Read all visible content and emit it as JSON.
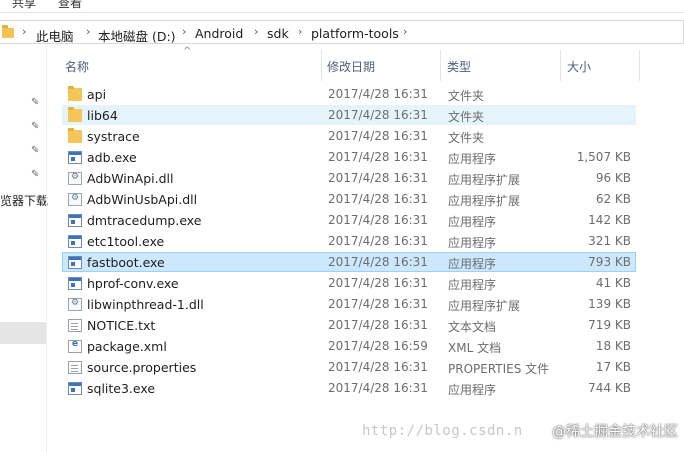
{
  "ribbon": {
    "tab1": "共享",
    "tab2": "查看"
  },
  "breadcrumb": {
    "items": [
      "此电脑",
      "本地磁盘 (D:)",
      "Android",
      "sdk",
      "platform-tools"
    ],
    "separator": "›"
  },
  "nav": {
    "cropped_label": "览器下载"
  },
  "columns": {
    "name": "名称",
    "date": "修改日期",
    "type": "类型",
    "size": "大小"
  },
  "files": [
    {
      "name": "api",
      "date": "2017/4/28 16:31",
      "type": "文件夹",
      "size": "",
      "icon": "folder-icon"
    },
    {
      "name": "lib64",
      "date": "2017/4/28 16:31",
      "type": "文件夹",
      "size": "",
      "icon": "folder-icon"
    },
    {
      "name": "systrace",
      "date": "2017/4/28 16:31",
      "type": "文件夹",
      "size": "",
      "icon": "folder-icon"
    },
    {
      "name": "adb.exe",
      "date": "2017/4/28 16:31",
      "type": "应用程序",
      "size": "1,507 KB",
      "icon": "exe-icon"
    },
    {
      "name": "AdbWinApi.dll",
      "date": "2017/4/28 16:31",
      "type": "应用程序扩展",
      "size": "96 KB",
      "icon": "dll-icon"
    },
    {
      "name": "AdbWinUsbApi.dll",
      "date": "2017/4/28 16:31",
      "type": "应用程序扩展",
      "size": "62 KB",
      "icon": "dll-icon"
    },
    {
      "name": "dmtracedump.exe",
      "date": "2017/4/28 16:31",
      "type": "应用程序",
      "size": "142 KB",
      "icon": "exe-icon"
    },
    {
      "name": "etc1tool.exe",
      "date": "2017/4/28 16:31",
      "type": "应用程序",
      "size": "321 KB",
      "icon": "exe-icon"
    },
    {
      "name": "fastboot.exe",
      "date": "2017/4/28 16:31",
      "type": "应用程序",
      "size": "793 KB",
      "icon": "exe-icon"
    },
    {
      "name": "hprof-conv.exe",
      "date": "2017/4/28 16:31",
      "type": "应用程序",
      "size": "41 KB",
      "icon": "exe-icon"
    },
    {
      "name": "libwinpthread-1.dll",
      "date": "2017/4/28 16:31",
      "type": "应用程序扩展",
      "size": "139 KB",
      "icon": "dll-icon"
    },
    {
      "name": "NOTICE.txt",
      "date": "2017/4/28 16:31",
      "type": "文本文档",
      "size": "719 KB",
      "icon": "text-document-icon"
    },
    {
      "name": "package.xml",
      "date": "2017/4/28 16:59",
      "type": "XML 文档",
      "size": "18 KB",
      "icon": "xml-document-icon"
    },
    {
      "name": "source.properties",
      "date": "2017/4/28 16:31",
      "type": "PROPERTIES 文件",
      "size": "17 KB",
      "icon": "document-icon"
    },
    {
      "name": "sqlite3.exe",
      "date": "2017/4/28 16:31",
      "type": "应用程序",
      "size": "744 KB",
      "icon": "exe-icon"
    }
  ],
  "watermark": {
    "url": "http://blog.csdn.n",
    "brand": "@稀土掘金技术社区"
  }
}
